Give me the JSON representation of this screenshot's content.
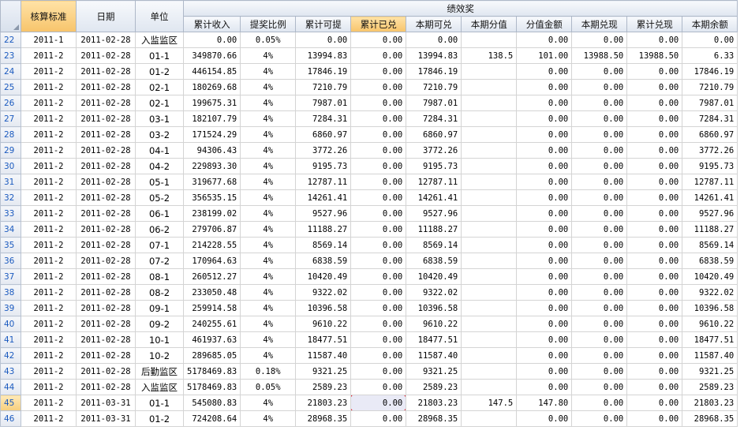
{
  "headers": {
    "col1": "核算标准",
    "col2": "日期",
    "col3": "单位",
    "group": "绩效奖",
    "sub": [
      "累计收入",
      "提奖比例",
      "累计可提",
      "累计已兑",
      "本期可兑",
      "本期分值",
      "分值金额",
      "本期兑现",
      "累计兑现",
      "本期余额"
    ]
  },
  "rows": [
    {
      "n": "22",
      "std": "2011-1",
      "date": "2011-02-28",
      "unit": "入监监区",
      "v": [
        "0.00",
        "0.05%",
        "0.00",
        "0.00",
        "0.00",
        "",
        "0.00",
        "0.00",
        "0.00",
        "0.00"
      ]
    },
    {
      "n": "23",
      "std": "2011-2",
      "date": "2011-02-28",
      "unit": "01-1",
      "v": [
        "349870.66",
        "4%",
        "13994.83",
        "0.00",
        "13994.83",
        "138.5",
        "101.00",
        "13988.50",
        "13988.50",
        "6.33"
      ]
    },
    {
      "n": "24",
      "std": "2011-2",
      "date": "2011-02-28",
      "unit": "01-2",
      "v": [
        "446154.85",
        "4%",
        "17846.19",
        "0.00",
        "17846.19",
        "",
        "0.00",
        "0.00",
        "0.00",
        "17846.19"
      ]
    },
    {
      "n": "25",
      "std": "2011-2",
      "date": "2011-02-28",
      "unit": "02-1",
      "v": [
        "180269.68",
        "4%",
        "7210.79",
        "0.00",
        "7210.79",
        "",
        "0.00",
        "0.00",
        "0.00",
        "7210.79"
      ]
    },
    {
      "n": "26",
      "std": "2011-2",
      "date": "2011-02-28",
      "unit": "02-1",
      "v": [
        "199675.31",
        "4%",
        "7987.01",
        "0.00",
        "7987.01",
        "",
        "0.00",
        "0.00",
        "0.00",
        "7987.01"
      ]
    },
    {
      "n": "27",
      "std": "2011-2",
      "date": "2011-02-28",
      "unit": "03-1",
      "v": [
        "182107.79",
        "4%",
        "7284.31",
        "0.00",
        "7284.31",
        "",
        "0.00",
        "0.00",
        "0.00",
        "7284.31"
      ]
    },
    {
      "n": "28",
      "std": "2011-2",
      "date": "2011-02-28",
      "unit": "03-2",
      "v": [
        "171524.29",
        "4%",
        "6860.97",
        "0.00",
        "6860.97",
        "",
        "0.00",
        "0.00",
        "0.00",
        "6860.97"
      ]
    },
    {
      "n": "29",
      "std": "2011-2",
      "date": "2011-02-28",
      "unit": "04-1",
      "v": [
        "94306.43",
        "4%",
        "3772.26",
        "0.00",
        "3772.26",
        "",
        "0.00",
        "0.00",
        "0.00",
        "3772.26"
      ]
    },
    {
      "n": "30",
      "std": "2011-2",
      "date": "2011-02-28",
      "unit": "04-2",
      "v": [
        "229893.30",
        "4%",
        "9195.73",
        "0.00",
        "9195.73",
        "",
        "0.00",
        "0.00",
        "0.00",
        "9195.73"
      ]
    },
    {
      "n": "31",
      "std": "2011-2",
      "date": "2011-02-28",
      "unit": "05-1",
      "v": [
        "319677.68",
        "4%",
        "12787.11",
        "0.00",
        "12787.11",
        "",
        "0.00",
        "0.00",
        "0.00",
        "12787.11"
      ]
    },
    {
      "n": "32",
      "std": "2011-2",
      "date": "2011-02-28",
      "unit": "05-2",
      "v": [
        "356535.15",
        "4%",
        "14261.41",
        "0.00",
        "14261.41",
        "",
        "0.00",
        "0.00",
        "0.00",
        "14261.41"
      ]
    },
    {
      "n": "33",
      "std": "2011-2",
      "date": "2011-02-28",
      "unit": "06-1",
      "v": [
        "238199.02",
        "4%",
        "9527.96",
        "0.00",
        "9527.96",
        "",
        "0.00",
        "0.00",
        "0.00",
        "9527.96"
      ]
    },
    {
      "n": "34",
      "std": "2011-2",
      "date": "2011-02-28",
      "unit": "06-2",
      "v": [
        "279706.87",
        "4%",
        "11188.27",
        "0.00",
        "11188.27",
        "",
        "0.00",
        "0.00",
        "0.00",
        "11188.27"
      ]
    },
    {
      "n": "35",
      "std": "2011-2",
      "date": "2011-02-28",
      "unit": "07-1",
      "v": [
        "214228.55",
        "4%",
        "8569.14",
        "0.00",
        "8569.14",
        "",
        "0.00",
        "0.00",
        "0.00",
        "8569.14"
      ]
    },
    {
      "n": "36",
      "std": "2011-2",
      "date": "2011-02-28",
      "unit": "07-2",
      "v": [
        "170964.63",
        "4%",
        "6838.59",
        "0.00",
        "6838.59",
        "",
        "0.00",
        "0.00",
        "0.00",
        "6838.59"
      ]
    },
    {
      "n": "37",
      "std": "2011-2",
      "date": "2011-02-28",
      "unit": "08-1",
      "v": [
        "260512.27",
        "4%",
        "10420.49",
        "0.00",
        "10420.49",
        "",
        "0.00",
        "0.00",
        "0.00",
        "10420.49"
      ]
    },
    {
      "n": "38",
      "std": "2011-2",
      "date": "2011-02-28",
      "unit": "08-2",
      "v": [
        "233050.48",
        "4%",
        "9322.02",
        "0.00",
        "9322.02",
        "",
        "0.00",
        "0.00",
        "0.00",
        "9322.02"
      ]
    },
    {
      "n": "39",
      "std": "2011-2",
      "date": "2011-02-28",
      "unit": "09-1",
      "v": [
        "259914.58",
        "4%",
        "10396.58",
        "0.00",
        "10396.58",
        "",
        "0.00",
        "0.00",
        "0.00",
        "10396.58"
      ]
    },
    {
      "n": "40",
      "std": "2011-2",
      "date": "2011-02-28",
      "unit": "09-2",
      "v": [
        "240255.61",
        "4%",
        "9610.22",
        "0.00",
        "9610.22",
        "",
        "0.00",
        "0.00",
        "0.00",
        "9610.22"
      ]
    },
    {
      "n": "41",
      "std": "2011-2",
      "date": "2011-02-28",
      "unit": "10-1",
      "v": [
        "461937.63",
        "4%",
        "18477.51",
        "0.00",
        "18477.51",
        "",
        "0.00",
        "0.00",
        "0.00",
        "18477.51"
      ]
    },
    {
      "n": "42",
      "std": "2011-2",
      "date": "2011-02-28",
      "unit": "10-2",
      "v": [
        "289685.05",
        "4%",
        "11587.40",
        "0.00",
        "11587.40",
        "",
        "0.00",
        "0.00",
        "0.00",
        "11587.40"
      ]
    },
    {
      "n": "43",
      "std": "2011-2",
      "date": "2011-02-28",
      "unit": "后勤监区",
      "v": [
        "5178469.83",
        "0.18%",
        "9321.25",
        "0.00",
        "9321.25",
        "",
        "0.00",
        "0.00",
        "0.00",
        "9321.25"
      ]
    },
    {
      "n": "44",
      "std": "2011-2",
      "date": "2011-02-28",
      "unit": "入监监区",
      "v": [
        "5178469.83",
        "0.05%",
        "2589.23",
        "0.00",
        "2589.23",
        "",
        "0.00",
        "0.00",
        "0.00",
        "2589.23"
      ]
    },
    {
      "n": "45",
      "std": "2011-2",
      "date": "2011-03-31",
      "unit": "01-1",
      "v": [
        "545080.83",
        "4%",
        "21803.23",
        "0.00",
        "21803.23",
        "147.5",
        "147.80",
        "0.00",
        "0.00",
        "21803.23"
      ]
    },
    {
      "n": "46",
      "std": "2011-2",
      "date": "2011-03-31",
      "unit": "01-2",
      "v": [
        "724208.64",
        "4%",
        "28968.35",
        "0.00",
        "28968.35",
        "",
        "0.00",
        "0.00",
        "0.00",
        "28968.35"
      ]
    }
  ]
}
